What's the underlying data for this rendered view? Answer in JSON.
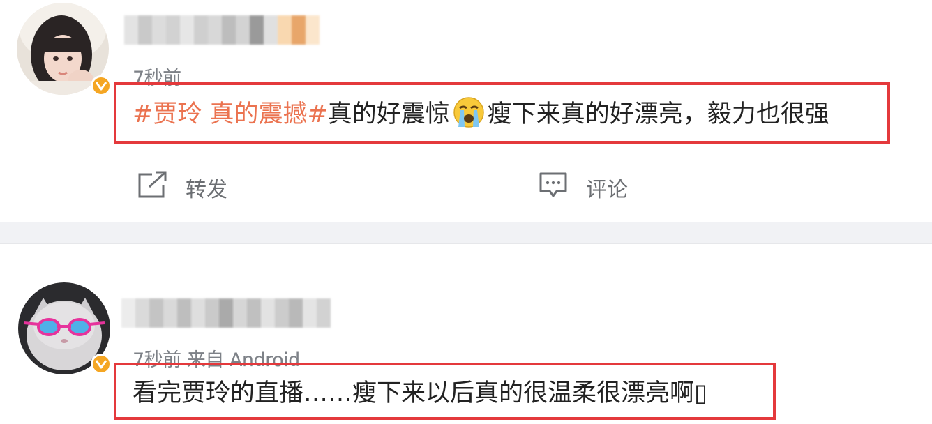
{
  "posts": [
    {
      "time_meta": "7秒前",
      "content": {
        "hashtag": "#贾玲 真的震撼#",
        "text_before_emoji": "真的好震惊",
        "emoji": "crying-face-emoji",
        "text_after_emoji": "瘦下来真的好漂亮，毅力也很强"
      },
      "actions": {
        "repost_label": "转发",
        "comment_label": "评论"
      },
      "avatar_icon": "user-avatar-girl",
      "verified_icon": "verified-badge-icon"
    },
    {
      "time_meta": "7秒前  来自 Android",
      "content": {
        "text": "看完贾玲的直播……瘦下来以后真的很温柔很漂亮啊▯"
      },
      "avatar_icon": "user-avatar-cat-sunglasses",
      "verified_icon": "verified-badge-icon"
    }
  ],
  "colors": {
    "hashtag": "#eb7350",
    "highlight_box": "#e4393c",
    "verified_badge": "#f5a623",
    "meta_text": "#7d8187"
  }
}
